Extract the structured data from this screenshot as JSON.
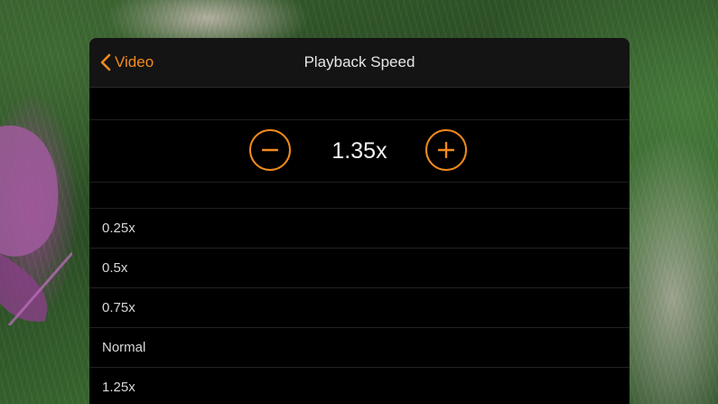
{
  "nav": {
    "back_label": "Video",
    "title": "Playback Speed"
  },
  "stepper": {
    "value": "1.35x",
    "decrement_icon": "minus-icon",
    "increment_icon": "plus-icon"
  },
  "options": [
    "0.25x",
    "0.5x",
    "0.75x",
    "Normal",
    "1.25x"
  ],
  "colors": {
    "accent": "#f28a1c",
    "panel_background": "#000000",
    "text": "#d8d8d8"
  }
}
